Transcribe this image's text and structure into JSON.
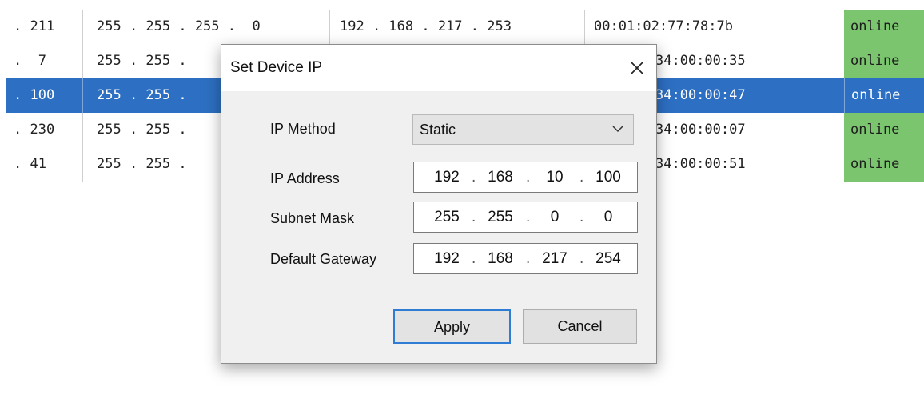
{
  "table": {
    "rows": [
      {
        "ip_tail": ". 211",
        "mask": "255 . 255 . 255 .  0",
        "gateway": "192 . 168 . 217 . 253",
        "mac": "00:01:02:77:78:7b",
        "status": "online",
        "selected": false
      },
      {
        "ip_tail": ".  7",
        "mask": "255 . 255 .",
        "gateway": "",
        "mac": "34:00:00:35",
        "status": "online",
        "selected": false
      },
      {
        "ip_tail": ". 100",
        "mask": "255 . 255 .",
        "gateway": "",
        "mac": "34:00:00:47",
        "status": "online",
        "selected": true
      },
      {
        "ip_tail": ". 230",
        "mask": "255 . 255 .",
        "gateway": "",
        "mac": "34:00:00:07",
        "status": "online",
        "selected": false
      },
      {
        "ip_tail": ". 41",
        "mask": "255 . 255 .",
        "gateway": "",
        "mac": "34:00:00:51",
        "status": "online",
        "selected": false
      }
    ],
    "colors": {
      "selected": "#2d6fc2",
      "online": "#7cc56f"
    }
  },
  "dialog": {
    "title": "Set Device IP",
    "close_icon": "close-icon",
    "ip_method": {
      "label": "IP Method",
      "value": "Static",
      "icon": "chevron-down-icon"
    },
    "ip_address": {
      "label": "IP Address",
      "octets": [
        "192",
        "168",
        "10",
        "100"
      ]
    },
    "subnet_mask": {
      "label": "Subnet Mask",
      "octets": [
        "255",
        "255",
        "0",
        "0"
      ]
    },
    "default_gateway": {
      "label": "Default Gateway",
      "octets": [
        "192",
        "168",
        "217",
        "254"
      ]
    },
    "apply_label": "Apply",
    "cancel_label": "Cancel",
    "accent": "#2f7cd4"
  }
}
